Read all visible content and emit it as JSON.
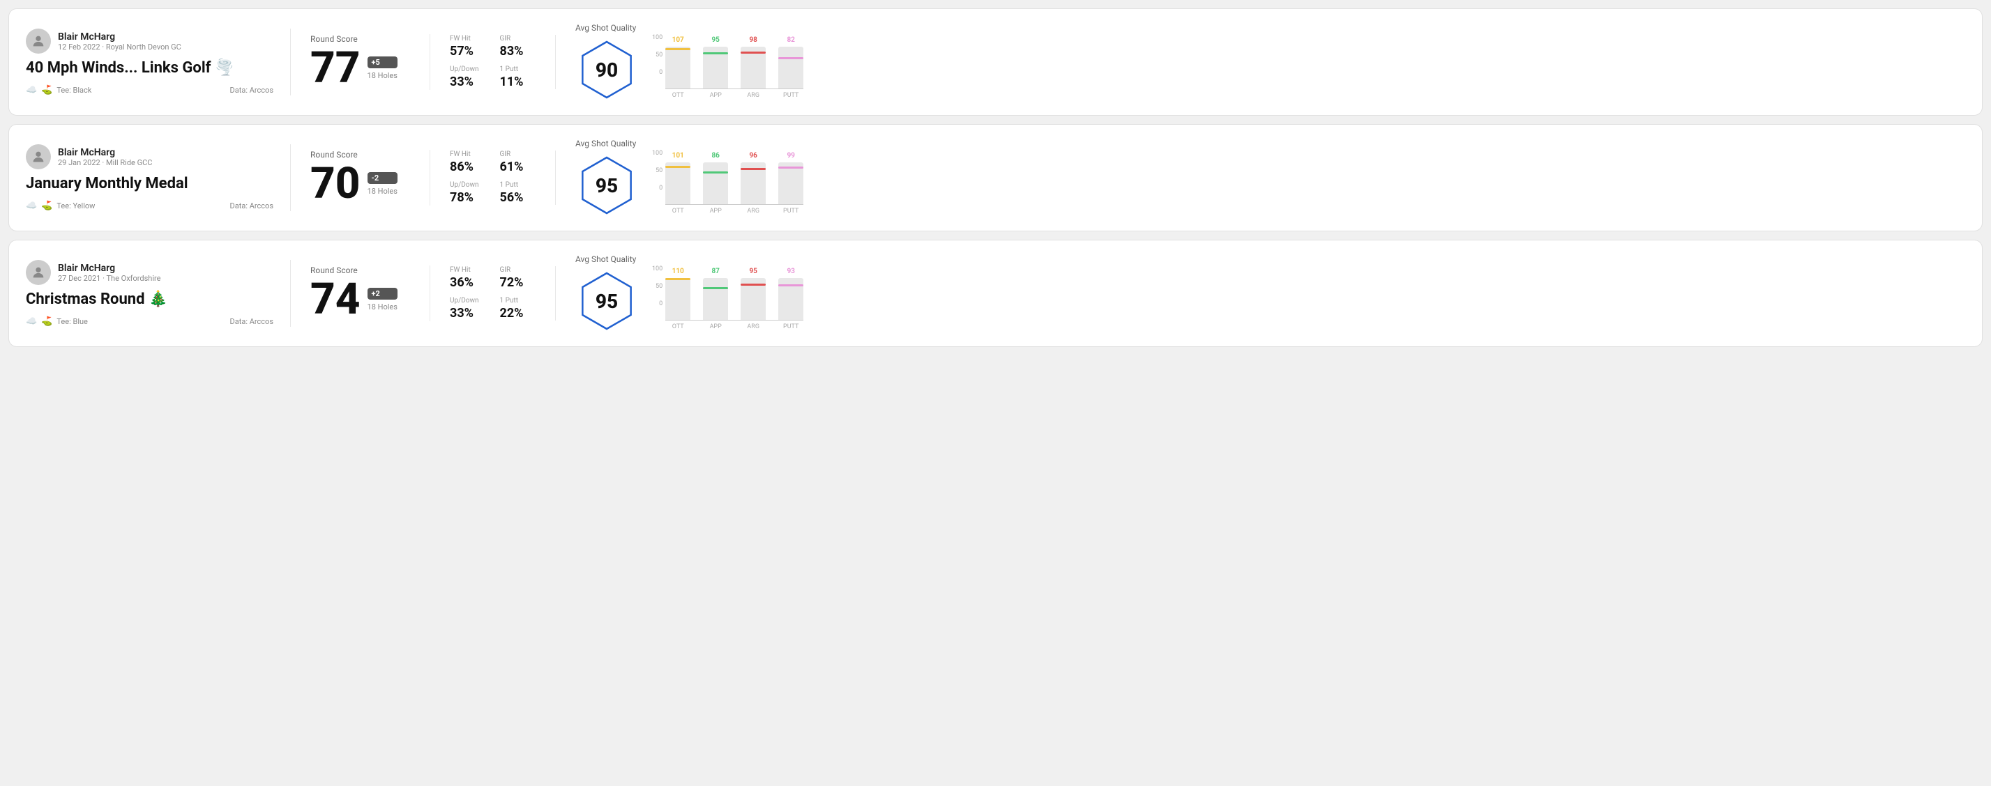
{
  "rounds": [
    {
      "id": "round1",
      "user": {
        "name": "Blair McHarg",
        "date": "12 Feb 2022 · Royal North Devon GC"
      },
      "title": "40 Mph Winds... Links Golf",
      "title_emoji": "🌪️",
      "tee": "Black",
      "data_source": "Data: Arccos",
      "score": {
        "label": "Round Score",
        "number": "77",
        "badge": "+5",
        "holes": "18 Holes"
      },
      "stats": {
        "fw_hit_label": "FW Hit",
        "fw_hit_value": "57%",
        "gir_label": "GIR",
        "gir_value": "83%",
        "updown_label": "Up/Down",
        "updown_value": "33%",
        "one_putt_label": "1 Putt",
        "one_putt_value": "11%"
      },
      "quality": {
        "label": "Avg Shot Quality",
        "score": "90",
        "bars": [
          {
            "label": "OTT",
            "value": 107,
            "color": "#f0c040"
          },
          {
            "label": "APP",
            "value": 95,
            "color": "#50c878"
          },
          {
            "label": "ARG",
            "value": 98,
            "color": "#e05050"
          },
          {
            "label": "PUTT",
            "value": 82,
            "color": "#e896d8"
          }
        ]
      }
    },
    {
      "id": "round2",
      "user": {
        "name": "Blair McHarg",
        "date": "29 Jan 2022 · Mill Ride GCC"
      },
      "title": "January Monthly Medal",
      "title_emoji": "",
      "tee": "Yellow",
      "data_source": "Data: Arccos",
      "score": {
        "label": "Round Score",
        "number": "70",
        "badge": "-2",
        "holes": "18 Holes"
      },
      "stats": {
        "fw_hit_label": "FW Hit",
        "fw_hit_value": "86%",
        "gir_label": "GIR",
        "gir_value": "61%",
        "updown_label": "Up/Down",
        "updown_value": "78%",
        "one_putt_label": "1 Putt",
        "one_putt_value": "56%"
      },
      "quality": {
        "label": "Avg Shot Quality",
        "score": "95",
        "bars": [
          {
            "label": "OTT",
            "value": 101,
            "color": "#f0c040"
          },
          {
            "label": "APP",
            "value": 86,
            "color": "#50c878"
          },
          {
            "label": "ARG",
            "value": 96,
            "color": "#e05050"
          },
          {
            "label": "PUTT",
            "value": 99,
            "color": "#e896d8"
          }
        ]
      }
    },
    {
      "id": "round3",
      "user": {
        "name": "Blair McHarg",
        "date": "27 Dec 2021 · The Oxfordshire"
      },
      "title": "Christmas Round",
      "title_emoji": "🎄",
      "tee": "Blue",
      "data_source": "Data: Arccos",
      "score": {
        "label": "Round Score",
        "number": "74",
        "badge": "+2",
        "holes": "18 Holes"
      },
      "stats": {
        "fw_hit_label": "FW Hit",
        "fw_hit_value": "36%",
        "gir_label": "GIR",
        "gir_value": "72%",
        "updown_label": "Up/Down",
        "updown_value": "33%",
        "one_putt_label": "1 Putt",
        "one_putt_value": "22%"
      },
      "quality": {
        "label": "Avg Shot Quality",
        "score": "95",
        "bars": [
          {
            "label": "OTT",
            "value": 110,
            "color": "#f0c040"
          },
          {
            "label": "APP",
            "value": 87,
            "color": "#50c878"
          },
          {
            "label": "ARG",
            "value": 95,
            "color": "#e05050"
          },
          {
            "label": "PUTT",
            "value": 93,
            "color": "#e896d8"
          }
        ]
      }
    }
  ],
  "y_axis_labels": [
    "100",
    "50",
    "0"
  ]
}
